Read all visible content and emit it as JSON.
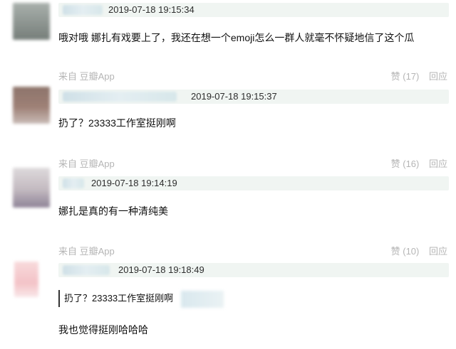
{
  "comments": [
    {
      "timestamp": "2019-07-18 19:15:34",
      "text": "哦对哦 娜扎有戏要上了，我还在想一个emoji怎么一群人就毫不怀疑地信了这个瓜",
      "source": "来自 豆瓣App",
      "like_label": "赞",
      "like_count": "(17)",
      "reply_label": "回应"
    },
    {
      "timestamp": "2019-07-18 19:15:37",
      "text": "扔了？23333工作室挺刚啊",
      "source": "来自 豆瓣App",
      "like_label": "赞",
      "like_count": "(16)",
      "reply_label": "回应"
    },
    {
      "timestamp": "2019-07-18 19:14:19",
      "text": "娜扎是真的有一种清纯美",
      "source": "来自 豆瓣App",
      "like_label": "赞",
      "like_count": "(10)",
      "reply_label": "回应"
    },
    {
      "timestamp": "2019-07-18 19:18:49",
      "quote": "扔了？23333工作室挺刚啊",
      "text": "我也觉得挺刚哈哈哈"
    }
  ],
  "colors": {
    "meta_bar_bg": "#f0f5f2",
    "muted_text": "#b5b5b5",
    "body_text": "#111111"
  }
}
